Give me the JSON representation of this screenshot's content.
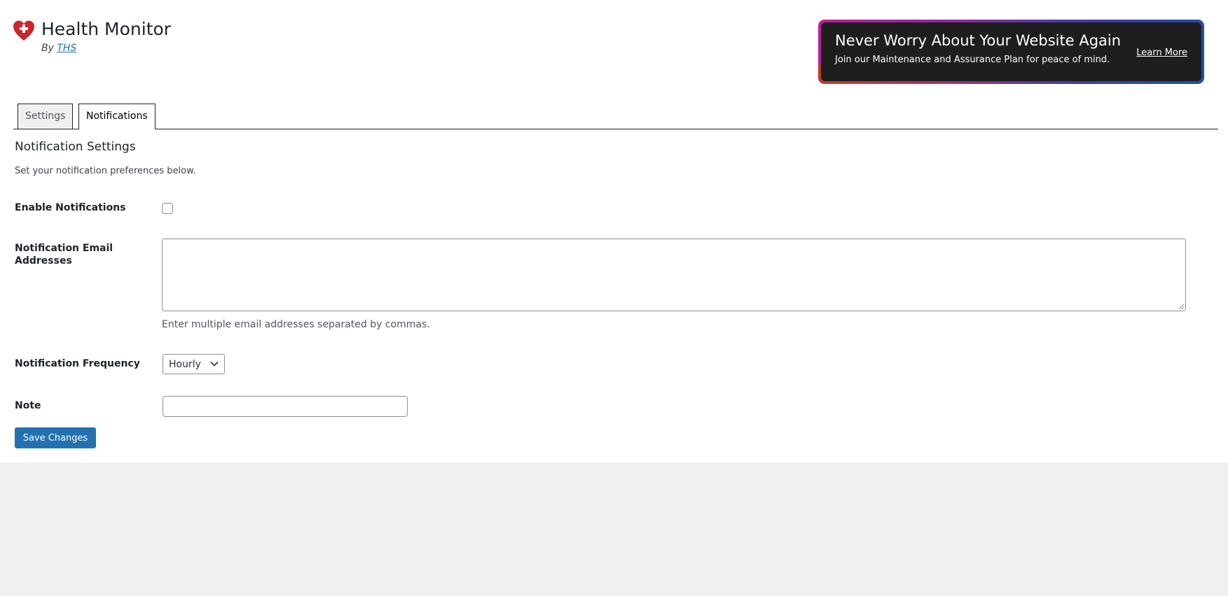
{
  "header": {
    "title": "Health Monitor",
    "by_prefix": "By",
    "by_link": "THS",
    "logo_icon": "heart-plus-icon",
    "logo_color": "#c9252c"
  },
  "promo": {
    "title": "Never Worry About Your Website Again",
    "subtitle": "Join our Maintenance and Assurance Plan for peace of mind.",
    "link": "Learn More"
  },
  "tabs": [
    {
      "label": "Settings",
      "active": false
    },
    {
      "label": "Notifications",
      "active": true
    }
  ],
  "section": {
    "title": "Notification Settings",
    "description": "Set your notification preferences below."
  },
  "fields": {
    "enable": {
      "label": "Enable Notifications",
      "checked": false
    },
    "emails": {
      "label": "Notification Email Addresses",
      "value": "",
      "help": "Enter multiple email addresses separated by commas."
    },
    "frequency": {
      "label": "Notification Frequency",
      "value": "Hourly"
    },
    "note": {
      "label": "Note",
      "value": ""
    }
  },
  "save_button": "Save Changes",
  "colors": {
    "primary": "#2271b1",
    "promo_bg": "#1e1e1e",
    "page_bg": "#f0f0f1"
  }
}
